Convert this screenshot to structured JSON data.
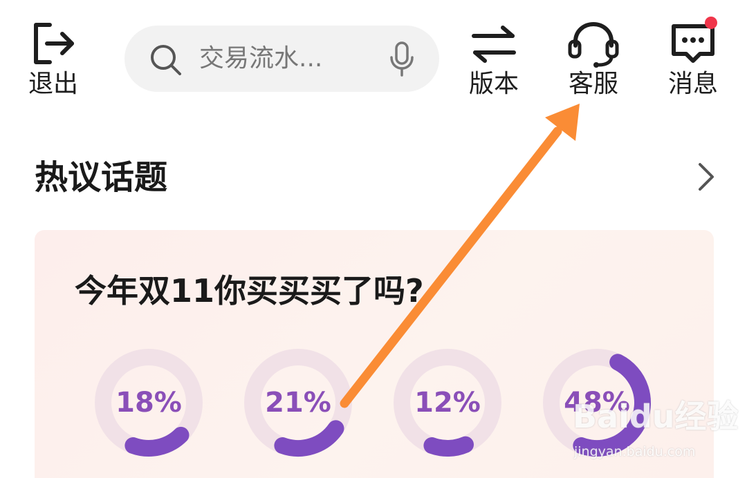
{
  "header": {
    "exit_label": "退出",
    "search_placeholder": "交易流水...",
    "version_label": "版本",
    "service_label": "客服",
    "message_label": "消息"
  },
  "section": {
    "title": "热议话题"
  },
  "poll": {
    "question": "今年双11你买买买了吗?",
    "options": [
      {
        "percent_label": "18%",
        "value": 18
      },
      {
        "percent_label": "21%",
        "value": 21
      },
      {
        "percent_label": "12%",
        "value": 12
      },
      {
        "percent_label": "48%",
        "value": 48
      }
    ]
  },
  "colors": {
    "accent": "#7e4cc0",
    "ring_track": "#f1e1e7",
    "badge": "#f0354a",
    "annotation_arrow": "#fa8c35"
  },
  "watermark": {
    "brand": "Baidu经验",
    "site": "jingyan.baidu.com"
  }
}
